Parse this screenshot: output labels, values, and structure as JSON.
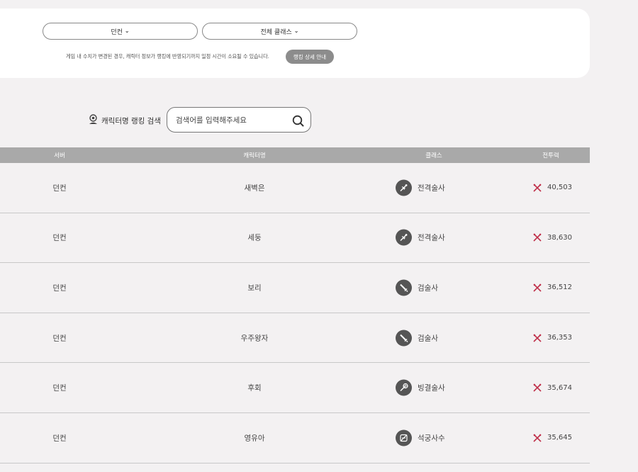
{
  "filters": {
    "server_select": "던컨",
    "class_select": "전체 클래스",
    "notice": "게임 내 수치가 변경된 경우, 캐릭터 정보가 랭킹에 반영되기까지 일정 시간이 소요될 수 있습니다.",
    "guide_button": "랭킹 상세 안내"
  },
  "search": {
    "label": "캐릭터명 랭킹 검색",
    "placeholder": "검색어를 입력해주세요"
  },
  "table": {
    "headers": {
      "server": "서버",
      "name": "캐릭터명",
      "class": "클래스",
      "power": "전투력"
    },
    "rows": [
      {
        "server": "던컨",
        "name": "새벽은",
        "class": "전격술사",
        "class_icon": "lightning-mage-icon",
        "power": "40,503"
      },
      {
        "server": "던컨",
        "name": "세둥",
        "class": "전격술사",
        "class_icon": "lightning-mage-icon",
        "power": "38,630"
      },
      {
        "server": "던컨",
        "name": "보리",
        "class": "검술사",
        "class_icon": "swordsman-icon",
        "power": "36,512"
      },
      {
        "server": "던컨",
        "name": "우주왕자",
        "class": "검술사",
        "class_icon": "swordsman-icon",
        "power": "36,353"
      },
      {
        "server": "던컨",
        "name": "후회",
        "class": "빙결술사",
        "class_icon": "ice-mage-icon",
        "power": "35,674"
      },
      {
        "server": "던컨",
        "name": "영유아",
        "class": "석궁사수",
        "class_icon": "crossbow-icon",
        "power": "35,645"
      }
    ]
  },
  "colors": {
    "header_bg": "#a9a9a9",
    "power_icon": "#c0304a",
    "class_icon_bg": "#555555",
    "guide_btn_bg": "#8c8c8c"
  }
}
